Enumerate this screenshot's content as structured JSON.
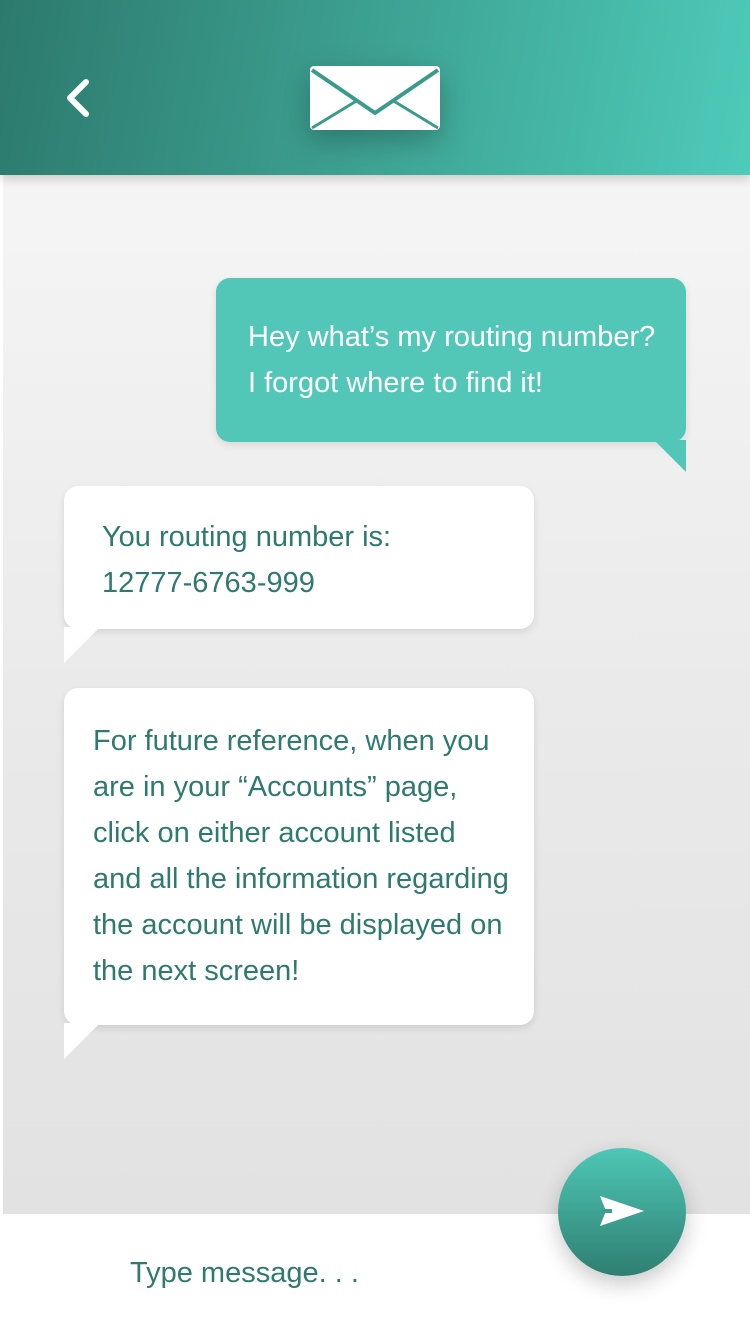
{
  "header": {
    "back_icon": "chevron-left-icon",
    "center_icon": "envelope-icon",
    "gradient_start": "#2c7a6d",
    "gradient_end": "#4ecbba"
  },
  "messages": [
    {
      "direction": "outgoing",
      "lines": [
        "Hey what’s my routing number?",
        "I forgot where to find it!"
      ],
      "bubble_color": "#52c7b8",
      "text_color": "#ffffff"
    },
    {
      "direction": "incoming",
      "lines": [
        "You routing number is:",
        "12777-6763-999"
      ],
      "bubble_color": "#ffffff",
      "text_color": "#2e7a6e"
    },
    {
      "direction": "incoming",
      "lines": [
        "For future reference, when you",
        "are in your “Accounts” page,",
        "click on either account listed",
        "and all the information regarding",
        "the account will be displayed on",
        "the next screen!"
      ],
      "bubble_color": "#ffffff",
      "text_color": "#2e7a6e"
    }
  ],
  "composer": {
    "placeholder": "Type message. . .",
    "value": "",
    "send_icon": "send-arrow-icon"
  }
}
